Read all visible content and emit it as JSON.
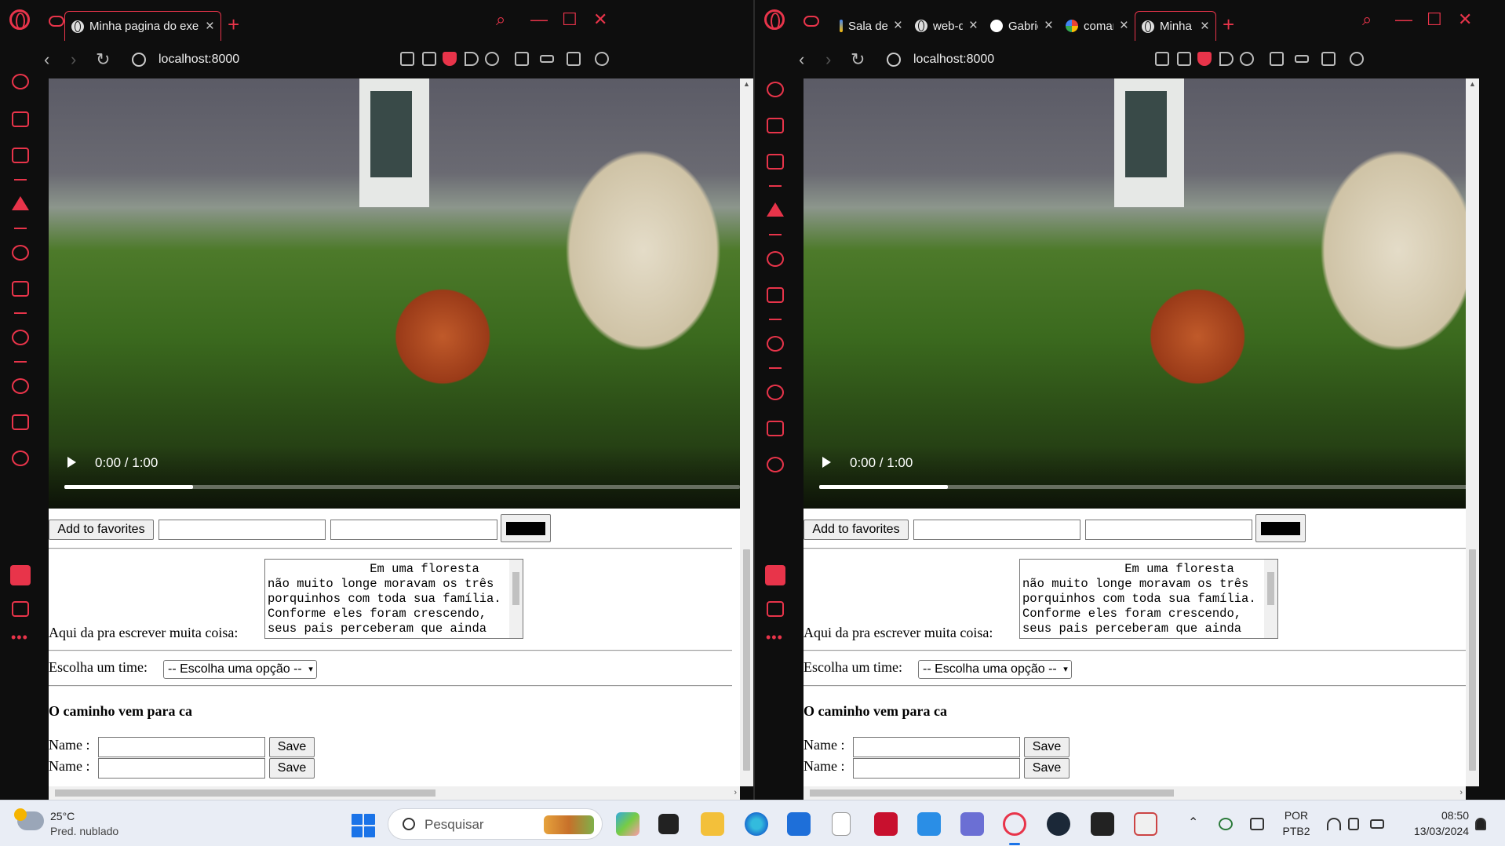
{
  "left_window": {
    "tabs": [
      {
        "label": "Minha pagina do exercicio",
        "favicon": "globe-icon",
        "active": true
      }
    ],
    "url": "localhost:8000",
    "scroll_h_fraction": 0.55
  },
  "right_window": {
    "tabs": [
      {
        "label": "Sala de",
        "favicon": "meet-icon",
        "active": false
      },
      {
        "label": "web-de",
        "favicon": "globe-icon",
        "active": false
      },
      {
        "label": "Gabriel",
        "favicon": "github-icon",
        "active": false
      },
      {
        "label": "comanc",
        "favicon": "google-icon",
        "active": false
      },
      {
        "label": "Minha p",
        "favicon": "globe-icon",
        "active": true
      }
    ],
    "url": "localhost:8000",
    "scroll_h_fraction": 0.55
  },
  "page": {
    "video": {
      "time": "0:00 / 1:00",
      "progress": 0.19
    },
    "favorites_button": "Add to favorites",
    "color_value": "#000000",
    "textarea_label": "Aqui da pra escrever muita coisa:",
    "textarea_text": "              Em uma floresta\nnão muito longe moravam os três\nporquinhos com toda sua família.\nConforme eles foram crescendo,\nseus pais perceberam que ainda",
    "select_label": "Escolha um time:",
    "select_value": "-- Escolha uma opção --",
    "heading": "O caminho vem para ca",
    "name_label": "Name :",
    "save_label": "Save"
  },
  "taskbar": {
    "weather_temp": "25°C",
    "weather_desc": "Pred. nublado",
    "search_placeholder": "Pesquisar",
    "language": "POR",
    "keyboard": "PTB2",
    "time": "08:50",
    "date": "13/03/2024"
  },
  "colors": {
    "accent": "#e8344a",
    "taskbar": "#e9edf5",
    "browser_bg": "#0e0e0e"
  }
}
